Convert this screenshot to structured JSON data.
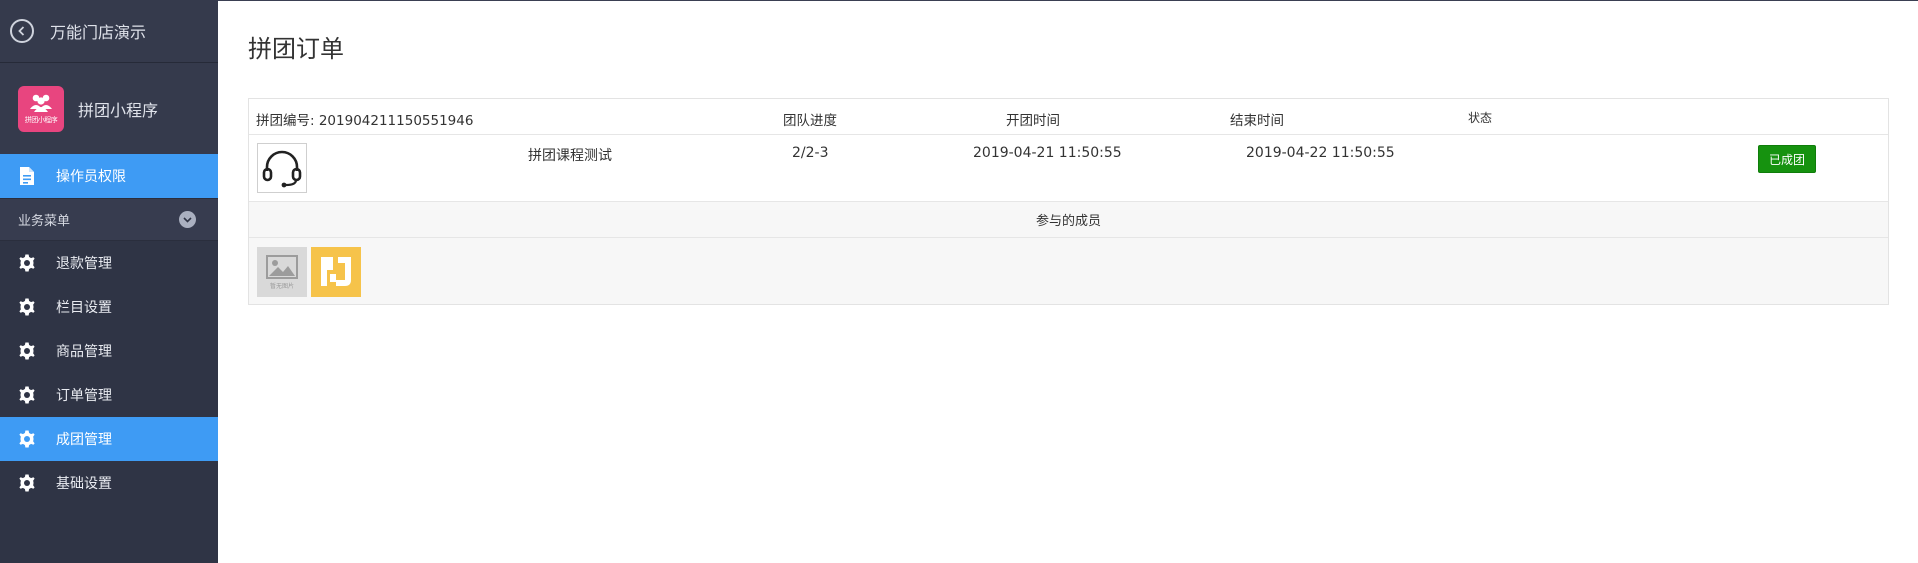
{
  "sidebar": {
    "store_title": "万能门店演示",
    "app_name": "拼团小程序",
    "app_logo_text": "拼团小程序",
    "operator_label": "操作员权限",
    "section_label": "业务菜单",
    "items": [
      {
        "label": "退款管理",
        "icon": "gear-icon",
        "active": false
      },
      {
        "label": "栏目设置",
        "icon": "gear-icon",
        "active": false
      },
      {
        "label": "商品管理",
        "icon": "gear-icon",
        "active": false
      },
      {
        "label": "订单管理",
        "icon": "gear-icon",
        "active": false
      },
      {
        "label": "成团管理",
        "icon": "gear-icon",
        "active": true
      },
      {
        "label": "基础设置",
        "icon": "gear-icon",
        "active": false
      }
    ]
  },
  "main": {
    "page_title": "拼团订单",
    "order": {
      "group_no": "拼团编号: 201904211150551946",
      "headers": {
        "progress": "团队进度",
        "start_time": "开团时间",
        "end_time": "结束时间",
        "status": "状态"
      },
      "item": {
        "name": "拼团课程测试",
        "progress": "2/2-3",
        "start_time": "2019-04-21 11:50:55",
        "end_time": "2019-04-22 11:50:55",
        "status": "已成团"
      },
      "members_label": "参与的成员",
      "placeholder_text": "暂无图片"
    }
  },
  "colors": {
    "sidebar_bg": "#2f3445",
    "active_blue": "#3e9bf4",
    "status_green": "#16920f",
    "app_logo_pink": "#e8457f",
    "member_logo_yellow": "#f6c34a"
  }
}
